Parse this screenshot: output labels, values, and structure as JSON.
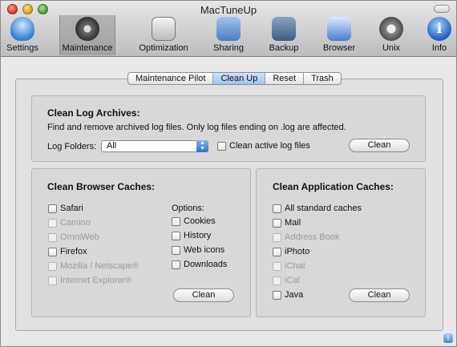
{
  "window": {
    "title": "MacTuneUp"
  },
  "toolbar": {
    "items": [
      {
        "label": "Settings",
        "icon": "settings-bulb-icon"
      },
      {
        "label": "Maintenance",
        "icon": "maintenance-gauge-icon",
        "selected": true
      },
      {
        "label": "Optimization",
        "icon": "optimization-icon"
      },
      {
        "label": "Sharing",
        "icon": "sharing-network-icon"
      },
      {
        "label": "Backup",
        "icon": "backup-disk-icon"
      },
      {
        "label": "Browser",
        "icon": "browser-monitor-icon"
      },
      {
        "label": "Unix",
        "icon": "unix-gear-icon"
      },
      {
        "label": "Info",
        "icon": "info-icon"
      }
    ]
  },
  "tabs": [
    {
      "label": "Maintenance Pilot",
      "active": false
    },
    {
      "label": "Clean Up",
      "active": true
    },
    {
      "label": "Reset",
      "active": false
    },
    {
      "label": "Trash",
      "active": false
    }
  ],
  "log_archives": {
    "title": "Clean Log Archives:",
    "description": "Find and remove archived log files. Only log files ending on .log are affected.",
    "folders_label": "Log Folders:",
    "folders_value": "All",
    "active_logs_label": "Clean active log files",
    "clean_label": "Clean"
  },
  "browser_caches": {
    "title": "Clean Browser Caches:",
    "browsers": [
      {
        "label": "Safari",
        "enabled": true
      },
      {
        "label": "Camino",
        "enabled": false
      },
      {
        "label": "OmniWeb",
        "enabled": false
      },
      {
        "label": "Firefox",
        "enabled": true
      },
      {
        "label": "Mozilla / Netscape®",
        "enabled": false
      },
      {
        "label": "Internet Explorer®",
        "enabled": false
      }
    ],
    "options_label": "Options:",
    "options": [
      {
        "label": "Cookies"
      },
      {
        "label": "History"
      },
      {
        "label": "Web icons"
      },
      {
        "label": "Downloads"
      }
    ],
    "clean_label": "Clean"
  },
  "app_caches": {
    "title": "Clean Application Caches:",
    "items": [
      {
        "label": "All standard caches",
        "enabled": true
      },
      {
        "label": "Mail",
        "enabled": true
      },
      {
        "label": "Address Book",
        "enabled": false
      },
      {
        "label": "iPhoto",
        "enabled": true
      },
      {
        "label": "iChat",
        "enabled": false
      },
      {
        "label": "iCal",
        "enabled": false
      },
      {
        "label": "Java",
        "enabled": true
      }
    ],
    "clean_label": "Clean"
  },
  "colors": {
    "accent": "#3a7fd0",
    "tab_active": "#b5d3f6"
  }
}
